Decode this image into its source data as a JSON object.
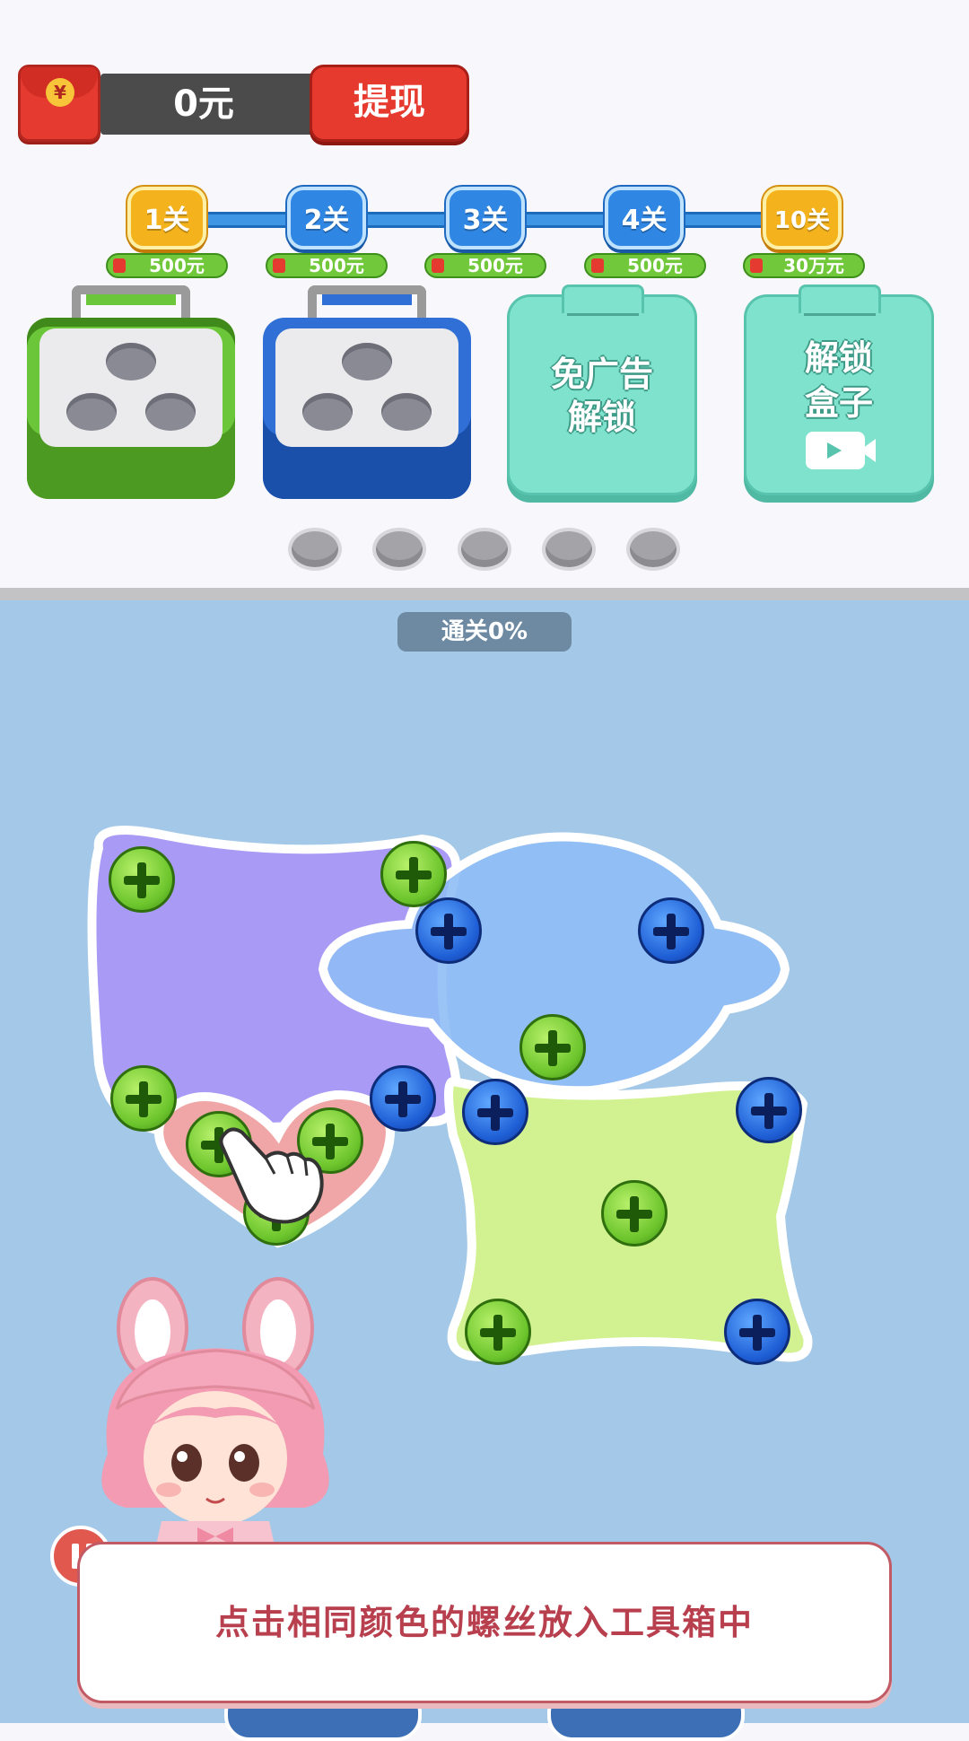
{
  "wallet": {
    "amount": "0元",
    "withdraw_label": "提现",
    "coin_symbol": "¥"
  },
  "levels": [
    {
      "label": "1关",
      "reward": "500元",
      "style": "gold"
    },
    {
      "label": "2关",
      "reward": "500元",
      "style": "blue"
    },
    {
      "label": "3关",
      "reward": "500元",
      "style": "blue"
    },
    {
      "label": "4关",
      "reward": "500元",
      "style": "blue"
    },
    {
      "label": "10关",
      "reward": "30万元",
      "style": "gold"
    }
  ],
  "toolboxes": [
    {
      "color": "green",
      "holes": 3
    },
    {
      "color": "blue",
      "holes": 3
    }
  ],
  "locked_boxes": [
    {
      "line1": "免广告",
      "line2": "解锁"
    },
    {
      "line1": "解锁",
      "line2": "盒子",
      "icon": "video-icon"
    }
  ],
  "empty_slots": 5,
  "progress": {
    "label": "通关0%",
    "value": 0
  },
  "colors": {
    "star_purple": "#a89af5",
    "ufo_blue": "#8fbcf5",
    "heart_pink": "#f0a6a6",
    "bowtie_green": "#d2f191",
    "screw_green": "#6cc52c",
    "screw_blue": "#1f5fd6",
    "background": "#a3c8e8"
  },
  "tip": {
    "text": "点击相同颜色的螺丝放入工具箱中"
  }
}
